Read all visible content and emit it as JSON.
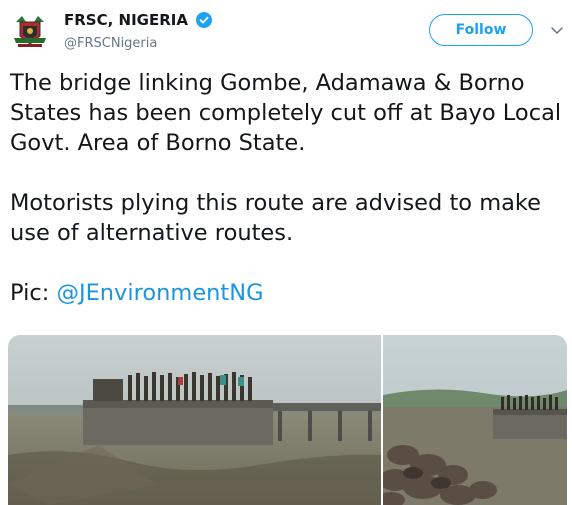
{
  "tweet": {
    "display_name": "FRSC, NIGERIA",
    "handle": "@FRSCNigeria",
    "follow_label": "Follow",
    "paragraph_1": "The bridge linking Gombe, Adamawa & Borno States has been completely cut off at Bayo Local Govt. Area of Borno State.",
    "paragraph_2": "Motorists plying this route are advised to make use of alternative routes.",
    "pic_prefix": "Pic:",
    "pic_mention": "@JEnvironmentNG"
  },
  "icons": {
    "avatar": "frsc-logo",
    "verified": "verified-badge-icon",
    "menu": "chevron-down-icon"
  },
  "colors": {
    "accent": "#1da1f2",
    "mention": "#1b95e0",
    "handle": "#657786"
  }
}
